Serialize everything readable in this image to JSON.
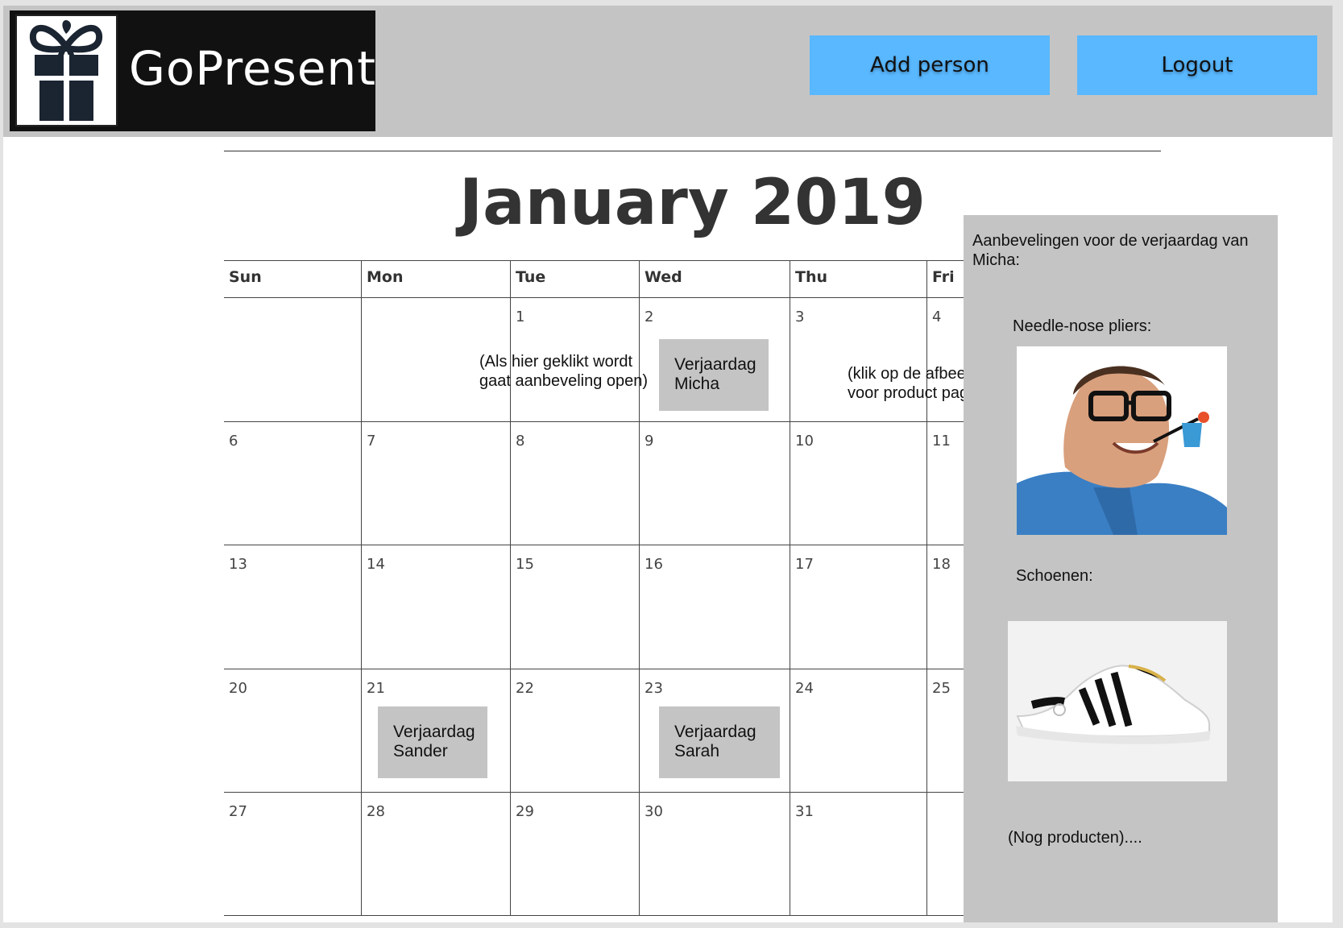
{
  "app": {
    "name": "GoPresent"
  },
  "header": {
    "add_person_label": "Add person",
    "logout_label": "Logout"
  },
  "calendar": {
    "title": "January 2019",
    "day_names": [
      "Sun",
      "Mon",
      "Tue",
      "Wed",
      "Thu",
      "Fri"
    ],
    "weeks": [
      [
        "",
        "",
        "1",
        "2",
        "3",
        "4"
      ],
      [
        "6",
        "7",
        "8",
        "9",
        "10",
        "11"
      ],
      [
        "13",
        "14",
        "15",
        "16",
        "17",
        "18"
      ],
      [
        "20",
        "21",
        "22",
        "23",
        "24",
        "25"
      ],
      [
        "27",
        "28",
        "29",
        "30",
        "31",
        ""
      ]
    ],
    "events": {
      "micha": "Verjaardag Micha",
      "sander": "Verjaardag Sander",
      "sarah": "Verjaardag Sarah"
    },
    "notes": {
      "click_hint": "(Als hier geklikt wordt\ngaat aanbeveling open)",
      "image_hint": "(klik op de afbeelding\nvoor product pagina)"
    }
  },
  "recommendations": {
    "title": "Aanbevelingen voor  de verjaardag van Micha:",
    "items": [
      {
        "label": "Needle-nose pliers:"
      },
      {
        "label": "Schoenen:"
      }
    ],
    "more": "(Nog producten)...."
  },
  "colors": {
    "header_bg": "#c4c4c4",
    "button_bg": "#59b8ff",
    "event_bg": "#c4c4c4",
    "panel_bg": "#c4c4c4"
  }
}
